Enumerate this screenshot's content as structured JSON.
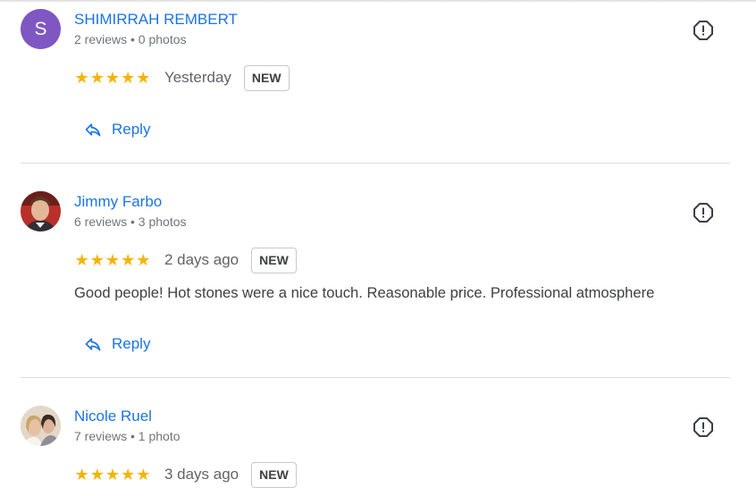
{
  "reviews": [
    {
      "name": "SHIMIRRAH REMBERT",
      "meta": "2 reviews • 0 photos",
      "avatar_letter": "S",
      "avatar_color": "#7e57c2",
      "stars": "★★★★★",
      "when": "Yesterday",
      "badge": "NEW",
      "text": "",
      "reply_label": "Reply"
    },
    {
      "name": "Jimmy Farbo",
      "meta": "6 reviews • 3 photos",
      "stars": "★★★★★",
      "when": "2 days ago",
      "badge": "NEW",
      "text": "Good people! Hot stones were a nice touch. Reasonable price. Professional atmosphere",
      "reply_label": "Reply"
    },
    {
      "name": "Nicole Ruel",
      "meta": "7 reviews • 1 photo",
      "stars": "★★★★★",
      "when": "3 days ago",
      "badge": "NEW"
    }
  ],
  "colors": {
    "link": "#1a73e8",
    "star": "#f4b400",
    "divider": "#dadce0"
  },
  "icons": {
    "flag": "report-flag-icon",
    "reply": "reply-arrow-icon"
  }
}
